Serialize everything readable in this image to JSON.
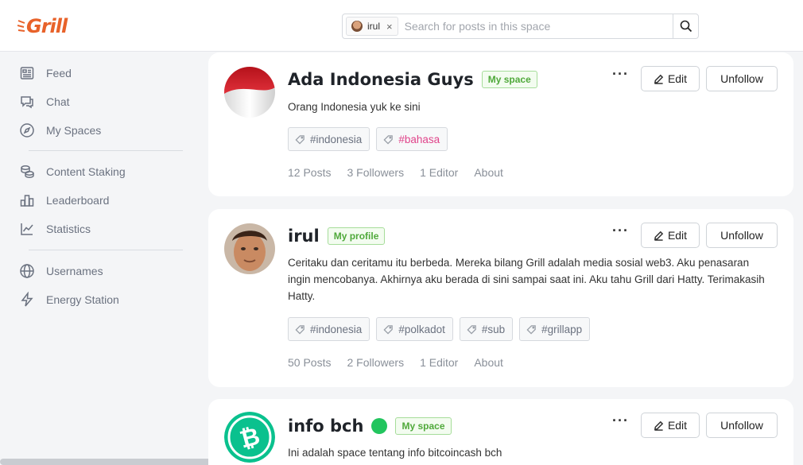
{
  "header": {
    "logo_text": "Grill",
    "search": {
      "chip_label": "irul",
      "chip_close": "×",
      "placeholder": "Search for posts in this space"
    }
  },
  "sidebar": {
    "items": [
      {
        "label": "Feed",
        "icon": "feed-icon"
      },
      {
        "label": "Chat",
        "icon": "chat-icon"
      },
      {
        "label": "My Spaces",
        "icon": "compass-icon"
      },
      {
        "label": "Content Staking",
        "icon": "coins-icon"
      },
      {
        "label": "Leaderboard",
        "icon": "leaderboard-icon"
      },
      {
        "label": "Statistics",
        "icon": "statistics-icon"
      },
      {
        "label": "Usernames",
        "icon": "globe-icon"
      },
      {
        "label": "Energy Station",
        "icon": "lightning-icon"
      }
    ]
  },
  "cards": [
    {
      "title": "Ada Indonesia Guys",
      "badge": "My space",
      "description": "Orang Indonesia yuk ke sini",
      "tags": [
        "#indonesia",
        "#bahasa"
      ],
      "stats": [
        "12 Posts",
        "3 Followers",
        "1 Editor",
        "About"
      ],
      "more": "···",
      "edit_label": "Edit",
      "unfollow_label": "Unfollow",
      "avatar": "indonesia-flag"
    },
    {
      "title": "irul",
      "badge": "My profile",
      "description": "Ceritaku dan ceritamu itu berbeda. Mereka bilang Grill adalah media sosial web3. Aku penasaran ingin mencobanya. Akhirnya aku berada di sini sampai saat ini. Aku tahu Grill dari Hatty. Terimakasih Hatty.",
      "tags": [
        "#indonesia",
        "#polkadot",
        "#sub",
        "#grillapp"
      ],
      "stats": [
        "50 Posts",
        "2 Followers",
        "1 Editor",
        "About"
      ],
      "more": "···",
      "edit_label": "Edit",
      "unfollow_label": "Unfollow",
      "avatar": "user-photo"
    },
    {
      "title": "info bch",
      "badge": "My space",
      "description": "Ini adalah space tentang info bitcoincash bch",
      "more": "···",
      "edit_label": "Edit",
      "unfollow_label": "Unfollow",
      "avatar": "bitcoin-cash-logo"
    }
  ],
  "colors": {
    "brand": "#e8622a",
    "badge_green": "#4fa93a",
    "tag_pink": "#e0448a",
    "verified_green": "#22c55e",
    "bch_green": "#0ac18e"
  }
}
